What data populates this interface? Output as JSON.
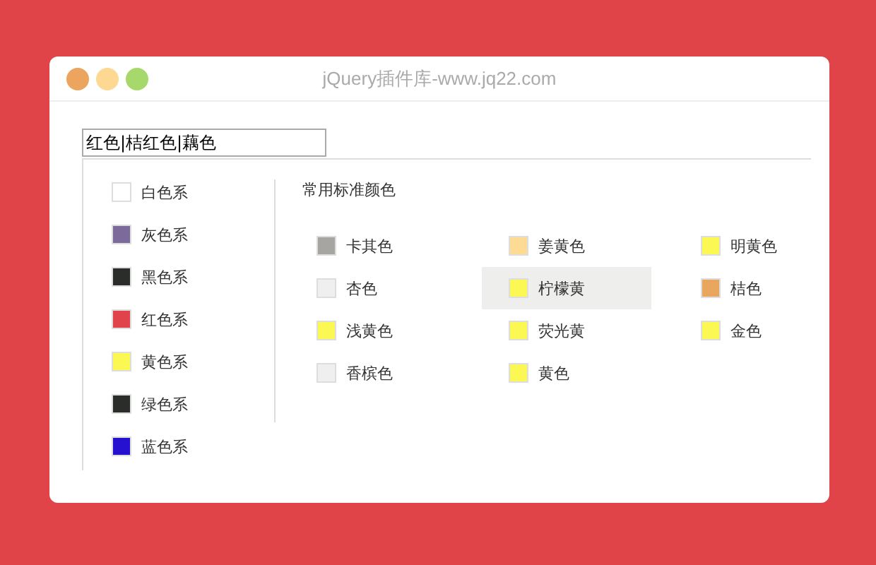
{
  "window": {
    "title": "jQuery插件库-www.jq22.com"
  },
  "input": {
    "value": "红色|桔红色|藕色"
  },
  "families": [
    {
      "label": "白色系",
      "color": "#ffffff"
    },
    {
      "label": "灰色系",
      "color": "#7b6a9a"
    },
    {
      "label": "黑色系",
      "color": "#2b2d2b"
    },
    {
      "label": "红色系",
      "color": "#e0434a"
    },
    {
      "label": "黄色系",
      "color": "#fbf753"
    },
    {
      "label": "绿色系",
      "color": "#2b2d2b"
    },
    {
      "label": "蓝色系",
      "color": "#2511cf"
    }
  ],
  "palette": {
    "title": "常用标准颜色",
    "colors": [
      {
        "label": "卡其色",
        "color": "#a6a5a1",
        "selected": false
      },
      {
        "label": "姜黄色",
        "color": "#fddb95",
        "selected": false
      },
      {
        "label": "明黄色",
        "color": "#fbf753",
        "selected": false
      },
      {
        "label": "杏色",
        "color": "#efefef",
        "selected": false
      },
      {
        "label": "柠檬黄",
        "color": "#fbf753",
        "selected": true
      },
      {
        "label": "桔色",
        "color": "#e9a65e",
        "selected": false
      },
      {
        "label": "浅黄色",
        "color": "#fbf753",
        "selected": false
      },
      {
        "label": "荧光黄",
        "color": "#fbf753",
        "selected": false
      },
      {
        "label": "金色",
        "color": "#fbf753",
        "selected": false
      },
      {
        "label": "香槟色",
        "color": "#efefef",
        "selected": false
      },
      {
        "label": "黄色",
        "color": "#fbf753",
        "selected": false
      }
    ]
  }
}
